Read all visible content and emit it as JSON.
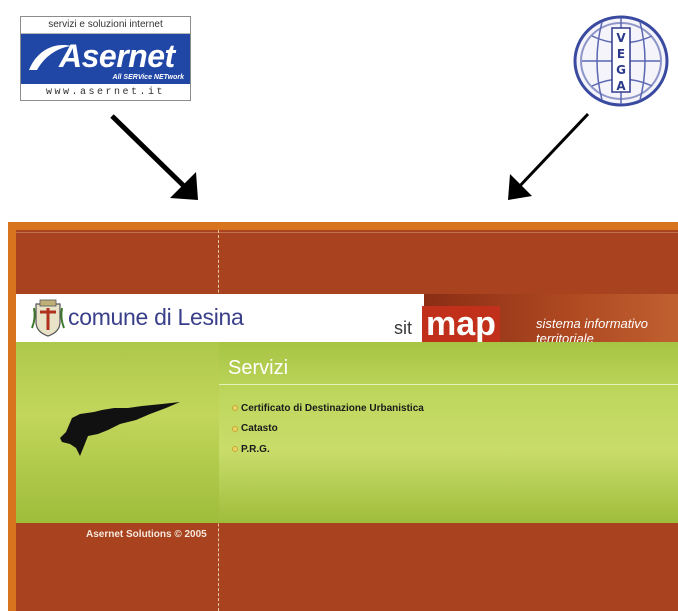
{
  "logos": {
    "asernet": {
      "top_text": "servizi e soluzioni internet",
      "name": "Asernet",
      "tagline": "All SERVice NETwork",
      "url": "www.asernet.it"
    },
    "vega": {
      "letters": [
        "V",
        "E",
        "G",
        "A"
      ]
    }
  },
  "header": {
    "comune_name": "comune di Lesina",
    "sit_label": "sit",
    "map_label": "map",
    "tagline": "sistema informativo territoriale"
  },
  "services": {
    "title": "Servizi",
    "items": [
      {
        "label": "Certificato di Destinazione Urbanistica"
      },
      {
        "label": "Catasto"
      },
      {
        "label": "P.R.G."
      }
    ]
  },
  "footer": {
    "copyright": "Asernet Solutions © 2005"
  },
  "colors": {
    "brand_blue": "#2147a6",
    "site_background": "#a8421f",
    "map_red": "#c0301b",
    "green_panel": "#b5cf52"
  }
}
